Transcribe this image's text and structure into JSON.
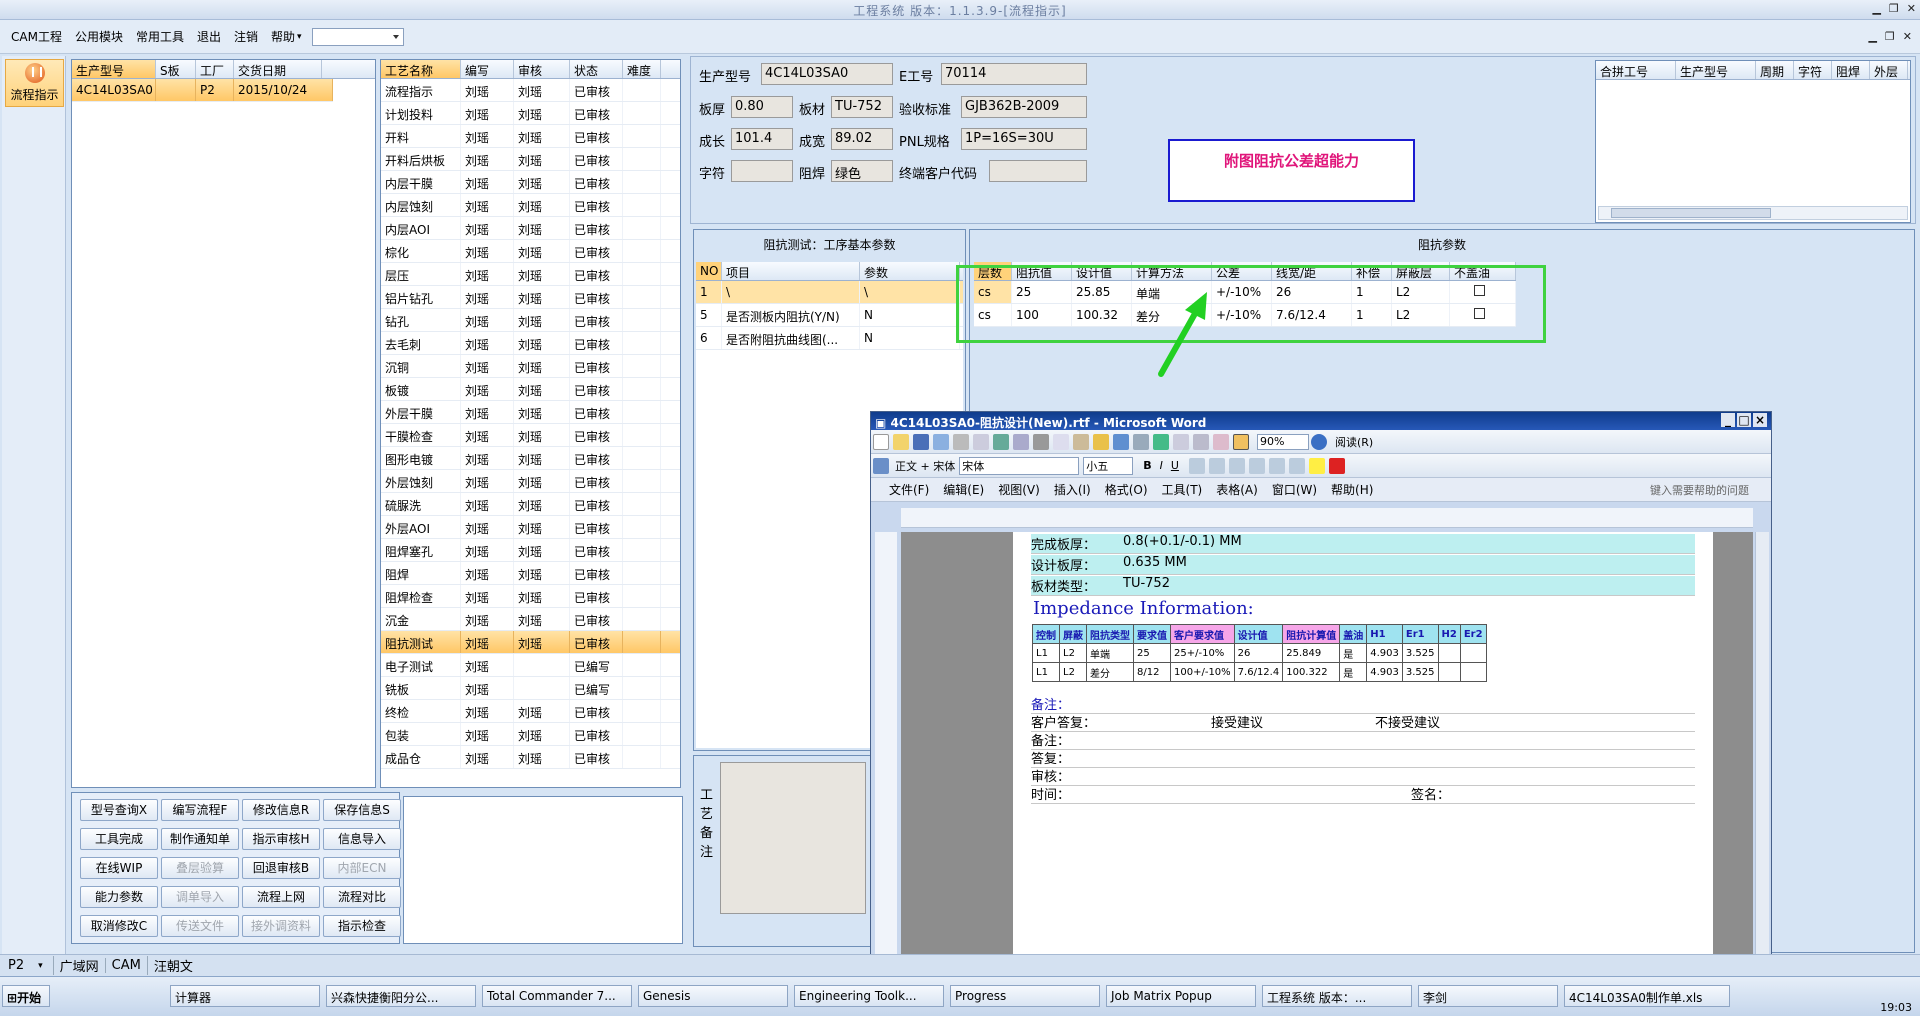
{
  "window": {
    "title": "工程系统 版本：1.1.3.9-[流程指示]"
  },
  "menu": [
    "CAM工程",
    "公用模块",
    "常用工具",
    "退出",
    "注销",
    "帮助"
  ],
  "left_strip": {
    "flow_button": "流程指示"
  },
  "product_list": {
    "headers": [
      "生产型号",
      "S板",
      "工厂",
      "交货日期"
    ],
    "rows": [
      [
        "4C14L03SA0",
        "",
        "P2",
        "2015/10/24"
      ]
    ]
  },
  "process_list": {
    "headers": [
      "工艺名称",
      "编写",
      "审核",
      "状态",
      "难度"
    ],
    "rows": [
      [
        "流程指示",
        "刘瑶",
        "刘瑶",
        "已审核"
      ],
      [
        "计划投料",
        "刘瑶",
        "刘瑶",
        "已审核"
      ],
      [
        "开料",
        "刘瑶",
        "刘瑶",
        "已审核"
      ],
      [
        "开料后烘板",
        "刘瑶",
        "刘瑶",
        "已审核"
      ],
      [
        "内层干膜",
        "刘瑶",
        "刘瑶",
        "已审核"
      ],
      [
        "内层蚀刻",
        "刘瑶",
        "刘瑶",
        "已审核"
      ],
      [
        "内层AOI",
        "刘瑶",
        "刘瑶",
        "已审核"
      ],
      [
        "棕化",
        "刘瑶",
        "刘瑶",
        "已审核"
      ],
      [
        "层压",
        "刘瑶",
        "刘瑶",
        "已审核"
      ],
      [
        "铝片钻孔",
        "刘瑶",
        "刘瑶",
        "已审核"
      ],
      [
        "钻孔",
        "刘瑶",
        "刘瑶",
        "已审核"
      ],
      [
        "去毛刺",
        "刘瑶",
        "刘瑶",
        "已审核"
      ],
      [
        "沉铜",
        "刘瑶",
        "刘瑶",
        "已审核"
      ],
      [
        "板镀",
        "刘瑶",
        "刘瑶",
        "已审核"
      ],
      [
        "外层干膜",
        "刘瑶",
        "刘瑶",
        "已审核"
      ],
      [
        "干膜检查",
        "刘瑶",
        "刘瑶",
        "已审核"
      ],
      [
        "图形电镀",
        "刘瑶",
        "刘瑶",
        "已审核"
      ],
      [
        "外层蚀刻",
        "刘瑶",
        "刘瑶",
        "已审核"
      ],
      [
        "硫脲洗",
        "刘瑶",
        "刘瑶",
        "已审核"
      ],
      [
        "外层AOI",
        "刘瑶",
        "刘瑶",
        "已审核"
      ],
      [
        "阻焊塞孔",
        "刘瑶",
        "刘瑶",
        "已审核"
      ],
      [
        "阻焊",
        "刘瑶",
        "刘瑶",
        "已审核"
      ],
      [
        "阻焊检查",
        "刘瑶",
        "刘瑶",
        "已审核"
      ],
      [
        "沉金",
        "刘瑶",
        "刘瑶",
        "已审核"
      ],
      [
        "阻抗测试",
        "刘瑶",
        "刘瑶",
        "已审核"
      ],
      [
        "电子测试",
        "刘瑶",
        "",
        "已编写"
      ],
      [
        "铣板",
        "刘瑶",
        "",
        "已编写"
      ],
      [
        "终检",
        "刘瑶",
        "刘瑶",
        "已审核"
      ],
      [
        "包装",
        "刘瑶",
        "刘瑶",
        "已审核"
      ],
      [
        "成品仓",
        "刘瑶",
        "刘瑶",
        "已审核"
      ]
    ],
    "selected_index": 24
  },
  "buttons": [
    "型号查询X",
    "编写流程F",
    "修改信息R",
    "保存信息S",
    "工具完成",
    "制作通知单",
    "指示审核H",
    "信息导入",
    "在线WIP",
    "叠层验算",
    "回退审核B",
    "内部ECN",
    "能力参数",
    "调单导入",
    "流程上网",
    "流程对比",
    "取消修改C",
    "传送文件",
    "接外调资料",
    "指示检查"
  ],
  "info": {
    "model_label": "生产型号",
    "model": "4C14L03SA0",
    "eno_label": "E工号",
    "eno": "70114",
    "thick_label": "板厚",
    "thick": "0.80",
    "mat_label": "板材",
    "mat": "TU-752",
    "std_label": "验收标准",
    "std": "GJB362B-2009",
    "len_label": "成长",
    "len": "101.4",
    "wid_label": "成宽",
    "wid": "89.02",
    "pnl_label": "PNL规格",
    "pnl": "1P=16S=30U",
    "char_label": "字符",
    "char": "",
    "mask_label": "阻焊",
    "mask": "绿色",
    "cust_label": "终端客户代码",
    "cust": ""
  },
  "notice": "附图阻抗公差超能力",
  "merge_list": {
    "headers": [
      "合拼工号",
      "生产型号",
      "周期",
      "字符",
      "阻焊",
      "外层"
    ]
  },
  "imp_basic": {
    "title": "阻抗测试：工序基本参数",
    "headers": [
      "NO",
      "项目",
      "参数"
    ],
    "rows": [
      [
        "1",
        "\\",
        "\\"
      ],
      [
        "5",
        "是否测板内阻抗(Y/N)",
        "N"
      ],
      [
        "6",
        "是否附阻抗曲线图(...",
        "N"
      ]
    ]
  },
  "imp_params": {
    "title": "阻抗参数",
    "headers": [
      "层数",
      "阻抗值",
      "设计值",
      "计算方法",
      "公差",
      "线宽/距",
      "补偿",
      "屏蔽层",
      "不盖油"
    ],
    "rows": [
      [
        "cs",
        "25",
        "25.85",
        "单端",
        "+/-10%",
        "26",
        "1",
        "L2"
      ],
      [
        "cs",
        "100",
        "100.32",
        "差分",
        "+/-10%",
        "7.6/12.4",
        "1",
        "L2"
      ]
    ]
  },
  "remark_label": "工艺备注",
  "word": {
    "title": "4C14L03SA0-阻抗设计(New).rtf - Microsoft Word",
    "zoom": "90%",
    "read_mode": "阅读(R)",
    "style": "正文 + 宋体",
    "font": "宋体",
    "size": "小五",
    "menu": [
      "文件(F)",
      "编辑(E)",
      "视图(V)",
      "插入(I)",
      "格式(O)",
      "工具(T)",
      "表格(A)",
      "窗口(W)",
      "帮助(H)"
    ],
    "help_placeholder": "键入需要帮助的问题",
    "doc": {
      "finish_label": "完成板厚：",
      "finish": "0.8(+0.1/-0.1) MM",
      "design_label": "设计板厚：",
      "design": "0.635 MM",
      "type_label": "板材类型：",
      "type": "TU-752",
      "heading": "Impedance Information:",
      "table_headers": [
        "控制",
        "屏蔽",
        "阻抗类型",
        "要求值",
        "客户要求值",
        "设计值",
        "阻抗计算值",
        "盖油",
        "H1",
        "Er1",
        "H2",
        "Er2"
      ],
      "table_rows": [
        [
          "L1",
          "L2",
          "单端",
          "25",
          "25+/-10%",
          "26",
          "25.849",
          "是",
          "4.903",
          "3.525",
          "",
          ""
        ],
        [
          "L1",
          "L2",
          "差分",
          "8/12",
          "100+/-10%",
          "7.6/12.4",
          "100.322",
          "是",
          "4.903",
          "3.525",
          "",
          ""
        ]
      ],
      "remark1": "备注：",
      "reply_label": "客户答复：",
      "accept": "接受建议",
      "reject": "不接受建议",
      "remark2": "备注：",
      "answer": "答复：",
      "review": "审核：",
      "time": "时间：",
      "sign": "签名："
    }
  },
  "status": {
    "factory": "P2",
    "tabs": [
      "广域网",
      "CAM",
      "汪朝文"
    ]
  },
  "taskbar": {
    "start": "开始",
    "tasks": [
      "计算器",
      "兴森快捷衡阳分公...",
      "Total Commander 7...",
      "Genesis",
      "Engineering Toolk...",
      "Progress",
      "Job Matrix Popup",
      "工程系统  版本：...",
      "李剑",
      "4C14L03SA0制作单.xls"
    ],
    "clock": "19:03"
  }
}
